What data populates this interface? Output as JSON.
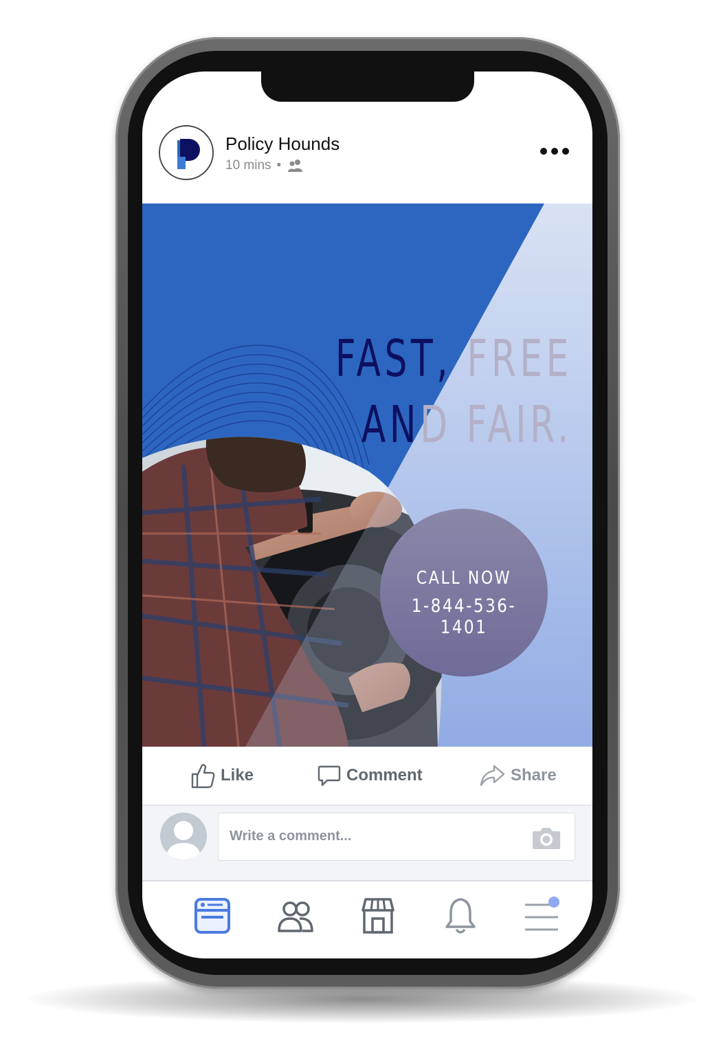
{
  "post": {
    "page_name": "Policy Hounds",
    "time": "10 mins",
    "separator": "•"
  },
  "ad": {
    "headline_line1_a": "FAST,",
    "headline_line1_b": "FREE",
    "headline_line2_a": "AN",
    "headline_line2_b": "D FAIR.",
    "cta_title": "CALL NOW",
    "cta_phone": "1-844-536-1401"
  },
  "actions": {
    "like": "Like",
    "comment": "Comment",
    "share": "Share"
  },
  "comment": {
    "placeholder": "Write a comment..."
  },
  "tabs": [
    "news-feed",
    "friends",
    "marketplace",
    "notifications",
    "menu"
  ],
  "colors": {
    "ad_blue": "#2c66c0",
    "headline_dark": "#0d1060",
    "headline_light": "#b3b0c8",
    "active_tab": "#4b7be0",
    "icon_gray": "#606770"
  }
}
